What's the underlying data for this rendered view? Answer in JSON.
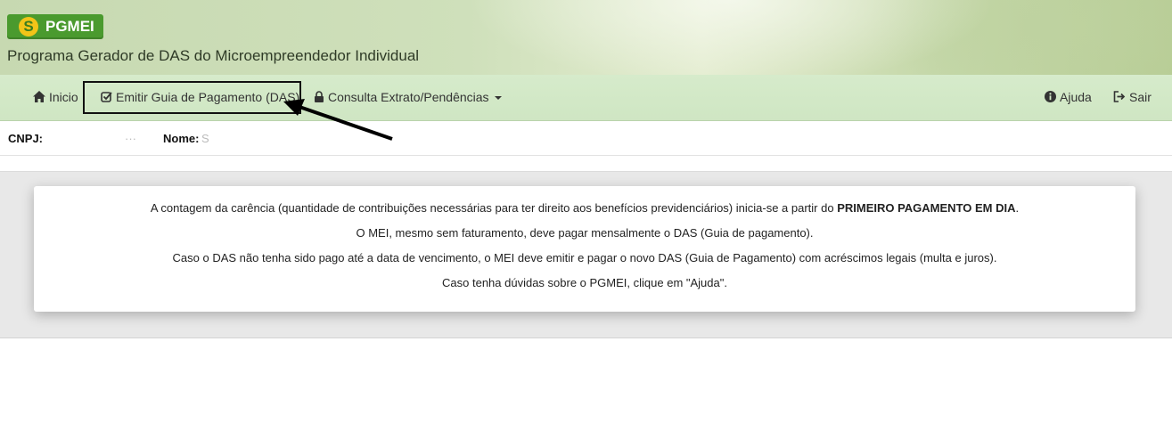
{
  "header": {
    "logo_mark": "S",
    "logo_text": "PGMEI",
    "app_title": "Programa Gerador de DAS do Microempreendedor Individual"
  },
  "nav": {
    "home_label": "Inicio",
    "emit_label": "Emitir Guia de Pagamento (DAS)",
    "consulta_label": "Consulta Extrato/Pendências",
    "help_label": "Ajuda",
    "exit_label": "Sair"
  },
  "info": {
    "cnpj_label": "CNPJ:",
    "cnpj_value": "···",
    "nome_label": "Nome:",
    "nome_value": "S"
  },
  "notice": {
    "line1_prefix": "A contagem da carência (quantidade de contribuições necessárias para ter direito aos benefícios previdenciários) inicia-se a partir do ",
    "line1_bold": "PRIMEIRO PAGAMENTO EM DIA",
    "line1_suffix": ".",
    "line2": "O MEI, mesmo sem faturamento, deve pagar mensalmente o DAS (Guia de pagamento).",
    "line3": "Caso o DAS não tenha sido pago até a data de vencimento, o MEI deve emitir e pagar o novo DAS (Guia de Pagamento) com acréscimos legais (multa e juros).",
    "line4": "Caso tenha dúvidas sobre o PGMEI, clique em \"Ajuda\"."
  },
  "colors": {
    "logo_bg": "#4a9a2e",
    "navbar_bg": "#d6ebcb",
    "highlight_border": "#111111"
  }
}
